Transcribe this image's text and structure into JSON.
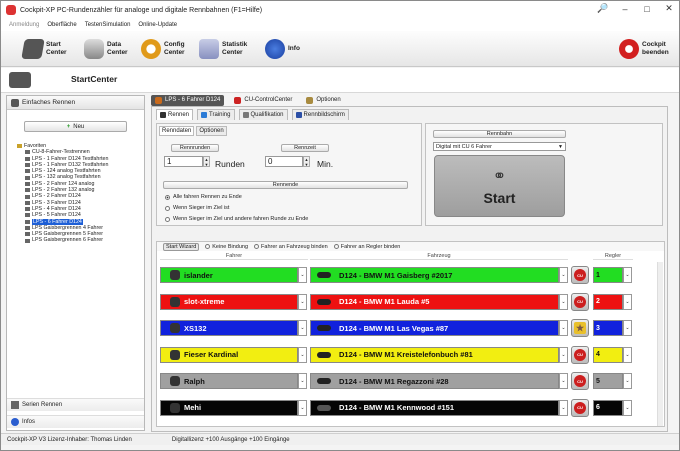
{
  "window": {
    "title": "Cockpit-XP PC-Rundenzähler für analoge und digitale Rennbahnen (F1=Hilfe)",
    "buttons": [
      "🔎",
      "–",
      "□",
      "✕"
    ]
  },
  "menu": [
    {
      "label": "Anmeldung",
      "disabled": true
    },
    {
      "label": "Oberfläche",
      "disabled": false
    },
    {
      "label": "TestenSimulation",
      "disabled": false
    },
    {
      "label": "Online-Update",
      "disabled": false
    }
  ],
  "toolbar": {
    "start_center": "Start\nCenter",
    "data_center": "Data\nCenter",
    "config_center": "Config\nCenter",
    "statistik_center": "Statistik\nCenter",
    "info": "Info",
    "cockpit_beenden": "Cockpit\nbeenden"
  },
  "center_title": "StartCenter",
  "left": {
    "header": "Einfaches Rennen",
    "new_button": "Neu",
    "tree": [
      {
        "label": "Favoriten",
        "root": true,
        "selected": false
      },
      {
        "label": "CU-8-Fahrer-Testrennen",
        "selected": false
      },
      {
        "label": "LPS - 1 Fahrer D124 Testfahrten",
        "selected": false
      },
      {
        "label": "LPS - 1 Fahrer D132 Testfahrten",
        "selected": false
      },
      {
        "label": "LPS - 124 analog Testfahrten",
        "selected": false
      },
      {
        "label": "LPS - 132 analog Testfahrten",
        "selected": false
      },
      {
        "label": "LPS - 2 Fahrer 124 analog",
        "selected": false
      },
      {
        "label": "LPS - 2 Fahrer 132 analog",
        "selected": false
      },
      {
        "label": "LPS - 2 Fahrer D124",
        "selected": false
      },
      {
        "label": "LPS - 3 Fahrer D124",
        "selected": false
      },
      {
        "label": "LPS - 4 Fahrer D124",
        "selected": false
      },
      {
        "label": "LPS - 5 Fahrer D124",
        "selected": false
      },
      {
        "label": "LPS - 6 Fahrer D124",
        "selected": true
      },
      {
        "label": "LPS Gaisbergrennen 4 Fahrer",
        "selected": false
      },
      {
        "label": "LPS Gaisbergrennen 5 Fahrer",
        "selected": false
      },
      {
        "label": "LPS Gaisbergrennen 6 Fahrer",
        "selected": false
      }
    ],
    "footer1": "Serien Rennen",
    "footer2": "Infos"
  },
  "top_tabs": [
    {
      "label": "LPS - 6 Fahrer D124",
      "active": true,
      "color": "#c96a1c"
    },
    {
      "label": "CU-ControlCenter",
      "active": false,
      "color": "#cc2222"
    },
    {
      "label": "Optionen",
      "active": false,
      "color": "#a88b40"
    }
  ],
  "sub_tabs": [
    {
      "label": "Rennen",
      "active": true,
      "color": "#333333"
    },
    {
      "label": "Training",
      "active": false,
      "color": "#2b7bd6"
    },
    {
      "label": "Qualifikation",
      "active": false,
      "color": "#777777"
    },
    {
      "label": "Rennbildschirm",
      "active": false,
      "color": "#2b4fa6"
    }
  ],
  "renndaten": {
    "tab_renndaten": "Renndaten",
    "tab_optionen": "Optionen",
    "btn_runden": "Rennrunden",
    "btn_zeit": "Rennzeit",
    "runden_value": "1",
    "runden_label": "Runden",
    "zeit_value": "0",
    "zeit_label": "Min.",
    "rennende_btn": "Rennende",
    "options": [
      {
        "label": "Alle fahren Rennen zu Ende",
        "checked": true
      },
      {
        "label": "Wenn Sieger im Ziel ist",
        "checked": false
      },
      {
        "label": "Wenn Sieger im Ziel und andere fahren Runde zu Ende",
        "checked": false
      }
    ]
  },
  "rennbahn": {
    "button": "Rennbahn",
    "selected": "Digital mit CU 6 Fahrer",
    "start": "Start"
  },
  "grid": {
    "start_wizard": "Start Wizard",
    "bind_options": [
      "Keine Bindung",
      "Fahrer an Fahrzeug binden",
      "Fahrer an Regler binden"
    ],
    "col_fahrer": "Fahrer",
    "col_fahrzeug": "Fahrzeug",
    "col_regler": "Regler",
    "rows": [
      {
        "driver": "islander",
        "car": "D124 - BMW M1 Gaisberg #2017",
        "regler": "1",
        "bg": "#22dd22",
        "fg": "#111111",
        "cu": "cu"
      },
      {
        "driver": "slot-xtreme",
        "car": "D124 - BMW M1 Lauda #5",
        "regler": "2",
        "bg": "#ee1111",
        "fg": "#ffffff",
        "cu": "cu"
      },
      {
        "driver": "XS132",
        "car": "D124 - BMW M1 Las Vegas #87",
        "regler": "3",
        "bg": "#1122dd",
        "fg": "#ffffff",
        "cu": "star"
      },
      {
        "driver": "Fieser Kardinal",
        "car": "D124 - BMW M1 Kreistelefonbuch #81",
        "regler": "4",
        "bg": "#f2ee11",
        "fg": "#111111",
        "cu": "cu"
      },
      {
        "driver": "Ralph",
        "car": "D124 - BMW M1 Regazzoni #28",
        "regler": "5",
        "bg": "#a0a0a0",
        "fg": "#111111",
        "cu": "cu"
      },
      {
        "driver": "Mehi",
        "car": "D124 - BMW M1 Kennwood #151",
        "regler": "6",
        "bg": "#050505",
        "fg": "#ffffff",
        "cu": "cu"
      }
    ]
  },
  "status": {
    "left": "Cockpit-XP V3 Lizenz-Inhaber: Thomas Linden",
    "right": "Digitallizenz  +100 Ausgänge +100 Eingänge"
  }
}
